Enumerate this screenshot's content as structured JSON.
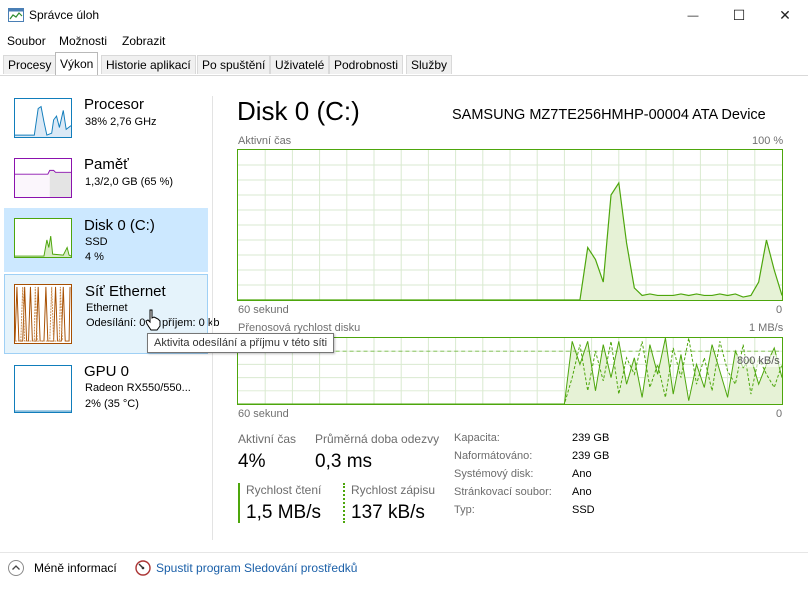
{
  "window": {
    "title": "Správce úloh",
    "controls": {
      "minimize": "—",
      "maximize": "☐",
      "close": "✕"
    }
  },
  "menu": [
    "Soubor",
    "Možnosti",
    "Zobrazit"
  ],
  "tabs": [
    "Procesy",
    "Výkon",
    "Historie aplikací",
    "Po spuštění",
    "Uživatelé",
    "Podrobnosti",
    "Služby"
  ],
  "active_tab": "Výkon",
  "sidebar": {
    "items": [
      {
        "name": "Procesor",
        "lines": [
          "38% 2,76 GHz"
        ],
        "color": "#117dbb"
      },
      {
        "name": "Paměť",
        "lines": [
          "1,3/2,0 GB (65 %)"
        ],
        "color": "#8b12ae"
      },
      {
        "name": "Disk 0 (C:)",
        "lines": [
          "SSD",
          "4 %"
        ],
        "color": "#4da60c",
        "selected": true
      },
      {
        "name": "Síť Ethernet",
        "lines": [
          "Ethernet",
          "Odesílání: 0",
          "příjem: 0 kb"
        ],
        "color": "#a74f01"
      },
      {
        "name": "GPU 0",
        "lines": [
          "Radeon RX550/550...",
          "2% (35 °C)"
        ],
        "color": "#117dbb"
      }
    ]
  },
  "tooltip": "Aktivita odesílání a příjmu v této síti",
  "detail": {
    "title": "Disk 0 (C:)",
    "model": "SAMSUNG MZ7TE256HMHP-00004 ATA Device",
    "graph1": {
      "label": "Aktivní čas",
      "max": "100 %",
      "xlabel": "60 sekund",
      "min": "0",
      "values": [
        0,
        0,
        0,
        0,
        0,
        0,
        0,
        0,
        0,
        0,
        0,
        0,
        0,
        0,
        0,
        0,
        0,
        0,
        0,
        0,
        0,
        0,
        0,
        0,
        0,
        0,
        0,
        0,
        0,
        0,
        0,
        0,
        0,
        0,
        0,
        0,
        0,
        0,
        0,
        0,
        0,
        0,
        0,
        0,
        0,
        35,
        27,
        12,
        70,
        78,
        38,
        8,
        3,
        4,
        3,
        3,
        3,
        4,
        3,
        4,
        3,
        3,
        4,
        3,
        4,
        2,
        3,
        12,
        40,
        20,
        3
      ]
    },
    "graph2": {
      "label": "Přenosová rychlost disku",
      "max": "1 MB/s",
      "marker": "800 kB/s",
      "xlabel": "60 sekund",
      "min": "0",
      "read": [
        0,
        0,
        0,
        0,
        0,
        0,
        0,
        0,
        0,
        0,
        0,
        0,
        0,
        0,
        0,
        0,
        0,
        0,
        0,
        0,
        0,
        0,
        0,
        0,
        0,
        0,
        0,
        0,
        0,
        0,
        0,
        0,
        0,
        0,
        0,
        0,
        0,
        0,
        0,
        0,
        0,
        0,
        0,
        95,
        60,
        95,
        20,
        90,
        40,
        95,
        30,
        70,
        10,
        90,
        45,
        100,
        15,
        75,
        5,
        60,
        25,
        90,
        50,
        10,
        80,
        55,
        70,
        30,
        60,
        85,
        40
      ],
      "write": [
        0,
        0,
        0,
        0,
        0,
        0,
        0,
        0,
        0,
        0,
        0,
        0,
        0,
        0,
        0,
        0,
        0,
        0,
        0,
        0,
        0,
        0,
        0,
        0,
        0,
        0,
        0,
        0,
        0,
        0,
        0,
        0,
        0,
        0,
        0,
        0,
        0,
        0,
        0,
        0,
        0,
        0,
        0,
        40,
        90,
        20,
        80,
        35,
        95,
        15,
        70,
        45,
        95,
        25,
        60,
        10,
        85,
        40,
        100,
        30,
        70,
        20,
        95,
        50,
        30,
        90,
        15,
        70,
        45,
        25,
        60
      ]
    },
    "stats": {
      "active_time": {
        "label": "Aktivní čas",
        "value": "4%"
      },
      "avg_response": {
        "label": "Průměrná doba odezvy",
        "value": "0,3 ms"
      },
      "read_speed": {
        "label": "Rychlost čtení",
        "value": "1,5 MB/s"
      },
      "write_speed": {
        "label": "Rychlost zápisu",
        "value": "137 kB/s"
      }
    },
    "properties": [
      {
        "label": "Kapacita:",
        "value": "239 GB"
      },
      {
        "label": "Naformátováno:",
        "value": "239 GB"
      },
      {
        "label": "Systémový disk:",
        "value": "Ano"
      },
      {
        "label": "Stránkovací soubor:",
        "value": "Ano"
      },
      {
        "label": "Typ:",
        "value": "SSD"
      }
    ]
  },
  "footer": {
    "less_info": "Méně informací",
    "open_monitor": "Spustit program Sledování prostředků"
  },
  "colors": {
    "disk": "#4da60c",
    "disk_fill": "#e6f2d6",
    "cpu": "#117dbb",
    "memory": "#8b12ae",
    "network": "#a74f01",
    "link": "#1a5fa8"
  }
}
